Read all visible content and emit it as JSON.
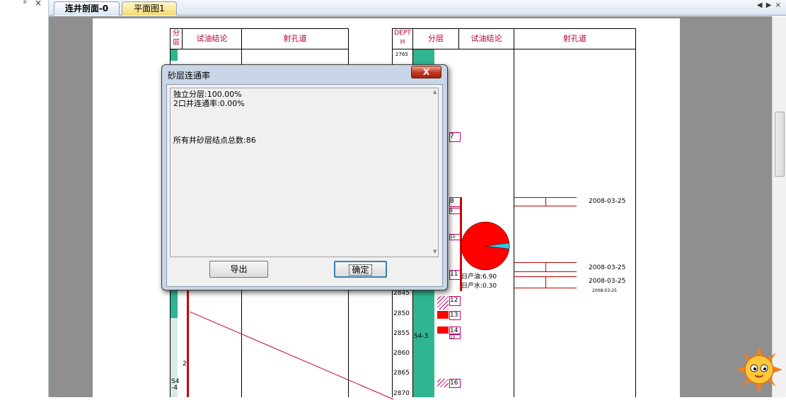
{
  "left_panel": {
    "pin_icon": "pin-icon",
    "close_icon": "close-icon",
    "pin": "ᵖ",
    "close": "×"
  },
  "tabs": [
    {
      "label": "连井剖面-0",
      "active": true
    },
    {
      "label": "平面图1",
      "active": false
    }
  ],
  "tab_nav": {
    "prev": "◀",
    "next": "▶",
    "close": "×"
  },
  "well_left": {
    "headers": {
      "layer": "分\n层",
      "test_conclusion": "试油结论",
      "perforation": "射孔道"
    },
    "layer_label": "S4-4",
    "layer_num": "2"
  },
  "well_right": {
    "headers": {
      "depth": "DEPTH",
      "layer": "分层",
      "test_conclusion": "试油结论",
      "perforation": "射孔道"
    },
    "depths": [
      "2765",
      "2845",
      "2850",
      "2855",
      "2860",
      "2865",
      "2870"
    ],
    "layer_numbers": [
      "7",
      "8",
      "9",
      "10",
      "11",
      "12",
      "13",
      "14",
      "15",
      "16"
    ],
    "zone_label": "S4-3",
    "production": {
      "oil": "日产油:6.90",
      "water": "日产水:0.30"
    },
    "dates": [
      "2008-03-25",
      "2008-03-25",
      "2008-03-25",
      "2008-03-25"
    ],
    "pie": {
      "oil_fraction": 0.96,
      "water_fraction": 0.04,
      "oil_color": "#ff0000",
      "water_color": "#36c9e8"
    }
  },
  "dialog": {
    "title": "砂层连通率",
    "close_label": "X",
    "lines": [
      "独立分层:100.00%",
      "2口井连通率:0.00%",
      "",
      "",
      "",
      "所有井砂层结点总数:86"
    ],
    "export_label": "导出",
    "ok_label": "确定"
  },
  "colors": {
    "teal": "#2fb58f",
    "header_text": "#b3002d",
    "layer_border": "#c0007a",
    "red": "#ff0000"
  }
}
